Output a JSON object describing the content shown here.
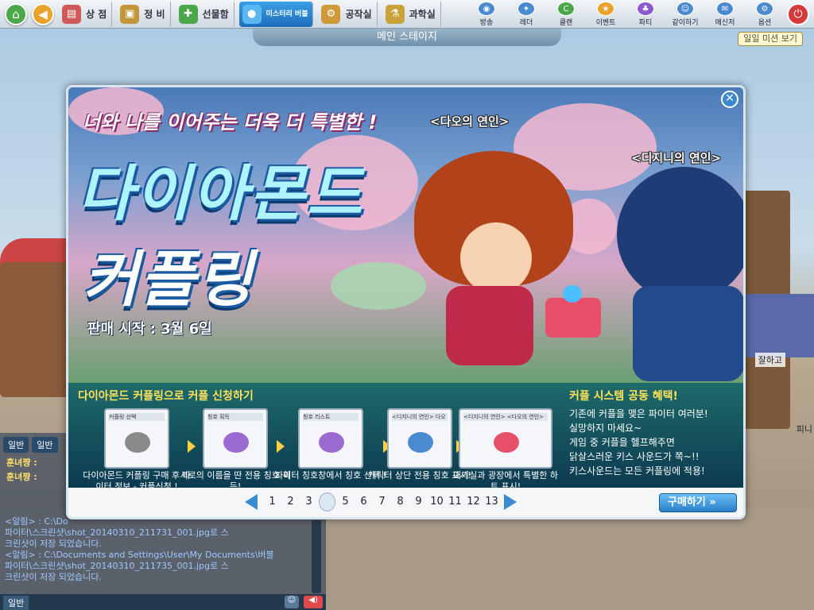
{
  "topbar": {
    "menu": [
      {
        "label": "상 점",
        "icon": "shop-icon",
        "color": "#d05a5a"
      },
      {
        "label": "정 비",
        "icon": "backpack-icon",
        "color": "#c4963a"
      },
      {
        "label": "선물함",
        "icon": "gift-icon",
        "color": "#4aa84a"
      },
      {
        "label": "미스터리 버블",
        "icon": "bubble-icon",
        "color": "#3a9ad8"
      },
      {
        "label": "공작실",
        "icon": "gear-icon",
        "color": "#d09a3a"
      },
      {
        "label": "과학실",
        "icon": "science-icon",
        "color": "#c9a23a"
      }
    ],
    "right_icons": [
      "방송",
      "레더",
      "클랜",
      "이벤트",
      "파티",
      "같이하기",
      "메신저",
      "옵션"
    ],
    "stage_title": "메인 스테이지",
    "mission_label": "일일 미션 보기"
  },
  "banner": {
    "tagline": "너와 나를 이어주는 더욱 더 특별한 !",
    "title_line1": "다이아몬드",
    "title_line2": "커플링",
    "sale_date": "판매 시작 : 3월 6일",
    "char_label_1": "<다오의 연인>",
    "char_label_2": "<디지니의 연인>"
  },
  "lower": {
    "heading_left": "다이아몬드 커플링으로 커플 신청하기",
    "heading_right": "커플 시스템 공동 혜택!",
    "steps": [
      {
        "caption": "다이아몬드 커플링 구매 후 파이터 정보 - 커플신청 !",
        "mini": "커플링 선택"
      },
      {
        "caption": "서로의 이름을 딴 전용 칭호 획득!",
        "mini": "칭호 획득"
      },
      {
        "caption": "파이터 칭호창에서 칭호 선택 !",
        "mini": "칭호 리스트"
      },
      {
        "caption": "캐릭터 상단 전용 칭호 표시!",
        "mini": "<디지니의 연인> 다오"
      },
      {
        "caption": "대기실과 광장에서 특별한 하트 표시!",
        "mini": "<디지니의 연인> <다오의 연인>"
      }
    ],
    "benefits": [
      "기존에 커플을 맺은 파이터 여러분!",
      "실망하지 마세요~",
      "게임 중 커플을 헬프해주면",
      "닭살스러운 키스 사운드가 쪽~!!",
      "키스사운드는 모든 커플링에 적용!"
    ]
  },
  "pager": {
    "pages": [
      "1",
      "2",
      "3",
      "4",
      "5",
      "6",
      "7",
      "8",
      "9",
      "10",
      "11",
      "12",
      "13"
    ],
    "current": "4",
    "buy_label": "구매하기"
  },
  "chat": {
    "tabs": [
      "일반",
      "일반"
    ],
    "users": [
      "훈녀쨩 :",
      "훈녀쨩 :"
    ],
    "lines": [
      "<알림> : C:\\Do",
      "파이터\\스크린샷\\shot_20140310_211731_001.jpg로 스",
      "크린샷이 저장 되었습니다.",
      "<알림> : C:\\Documents and Settings\\User\\My Documents\\버블",
      "파이터\\스크린샷\\shot_20140310_211735_001.jpg로 스",
      "크린샷이 저장 되었습니다."
    ],
    "bottom_select": "일반"
  },
  "side": {
    "text1": "잘하고",
    "text2": "피니"
  }
}
